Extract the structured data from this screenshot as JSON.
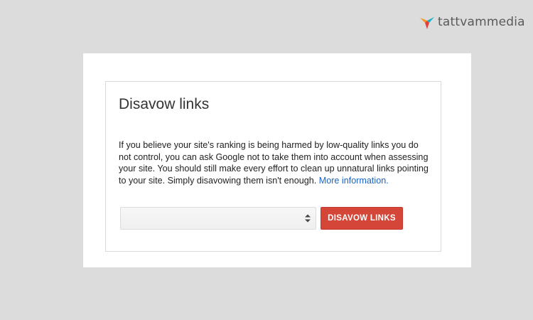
{
  "brand": {
    "name": "tattvammedia",
    "logo_icon": "bird-logo-icon",
    "colors": {
      "orange": "#f7941d",
      "teal": "#1ab0c8",
      "red": "#e2413b"
    }
  },
  "dialog": {
    "title": "Disavow links",
    "description": "If you believe your site's ranking is being harmed by low-quality links you do not control, you can ask Google not to take them into account when assessing your site. You should still make every effort to clean up unnatural links pointing to your site. Simply disavowing them isn't enough.",
    "more_link": "More information.",
    "site_select": {
      "value": "",
      "icon": "select-arrows-icon"
    },
    "disavow_button": "DISAVOW LINKS",
    "colors": {
      "button": "#d44638",
      "link": "#1a63c4"
    }
  }
}
